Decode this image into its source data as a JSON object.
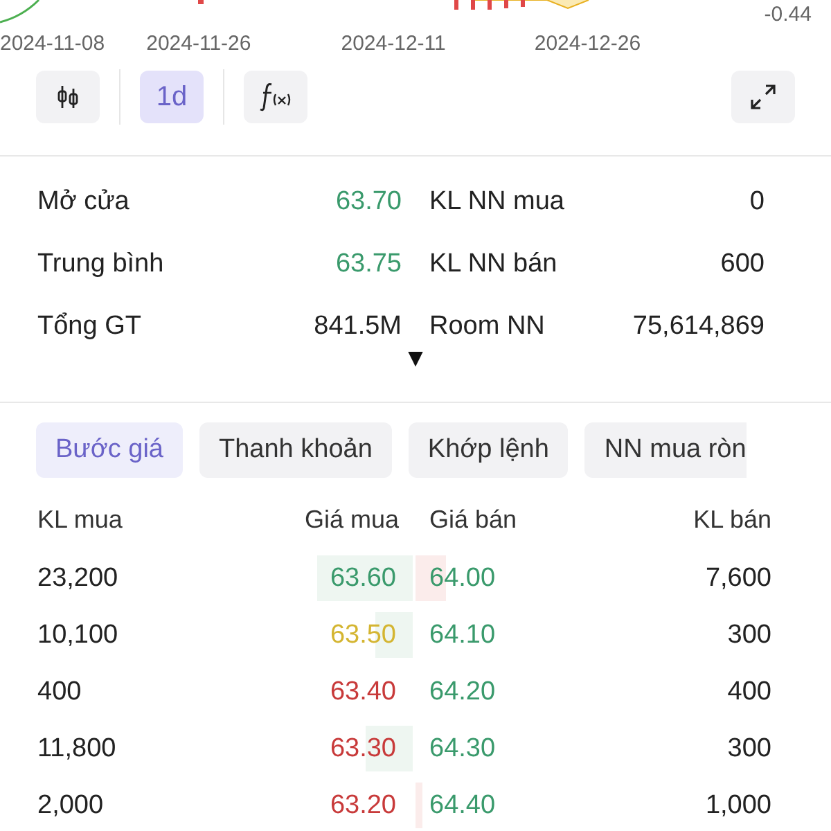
{
  "chart": {
    "edge_value": "-0.44",
    "dates": [
      "2024-11-08",
      "2024-11-26",
      "2024-12-11",
      "2024-12-26"
    ]
  },
  "toolbar": [
    {
      "kind": "candles",
      "selected": false
    },
    {
      "kind": "text",
      "label": "1d",
      "selected": true
    },
    {
      "kind": "fx",
      "selected": false
    }
  ],
  "stats": [
    {
      "label": "Mở cửa",
      "value": "63.70",
      "color": "#3a9a6c"
    },
    {
      "label": "KL NN mua",
      "value": "0"
    },
    {
      "label": "Trung bình",
      "value": "63.75",
      "color": "#3a9a6c"
    },
    {
      "label": "KL NN bán",
      "value": "600"
    },
    {
      "label": "Tổng GT",
      "value": "841.5M"
    },
    {
      "label": "Room NN",
      "value": "75,614,869"
    }
  ],
  "expand_marker": "▼",
  "tabs": [
    {
      "label": "Bước giá",
      "selected": true
    },
    {
      "label": "Thanh khoản",
      "selected": false
    },
    {
      "label": "Khớp lệnh",
      "selected": false
    },
    {
      "label": "NN mua ròn",
      "selected": false
    }
  ],
  "order_book": {
    "columns": [
      "KL mua",
      "Giá mua",
      "Giá bán",
      "KL bán"
    ],
    "rows": [
      {
        "buy_volume": "23,200",
        "buy_price": {
          "value": "63.60",
          "color": "#3a9a6c",
          "level": 0.68
        },
        "sell_price": {
          "value": "64.00",
          "color": "#3a9a6c",
          "level": 0.21
        },
        "sell_volume": "7,600"
      },
      {
        "buy_volume": "10,100",
        "buy_price": {
          "value": "63.50",
          "color": "#d4b531",
          "level": 0.27
        },
        "sell_price": {
          "value": "64.10",
          "color": "#3a9a6c"
        },
        "sell_volume": "300"
      },
      {
        "buy_volume": "400",
        "buy_price": {
          "value": "63.40",
          "color": "#c83a3a"
        },
        "sell_price": {
          "value": "64.20",
          "color": "#3a9a6c"
        },
        "sell_volume": "400"
      },
      {
        "buy_volume": "11,800",
        "buy_price": {
          "value": "63.30",
          "color": "#c83a3a",
          "level": 0.34
        },
        "sell_price": {
          "value": "64.30",
          "color": "#3a9a6c"
        },
        "sell_volume": "300"
      },
      {
        "buy_volume": "2,000",
        "buy_price": {
          "value": "63.20",
          "color": "#c83a3a"
        },
        "sell_price": {
          "value": "64.40",
          "color": "#3a9a6c",
          "level": 0.05
        },
        "sell_volume": "1,000"
      }
    ]
  }
}
